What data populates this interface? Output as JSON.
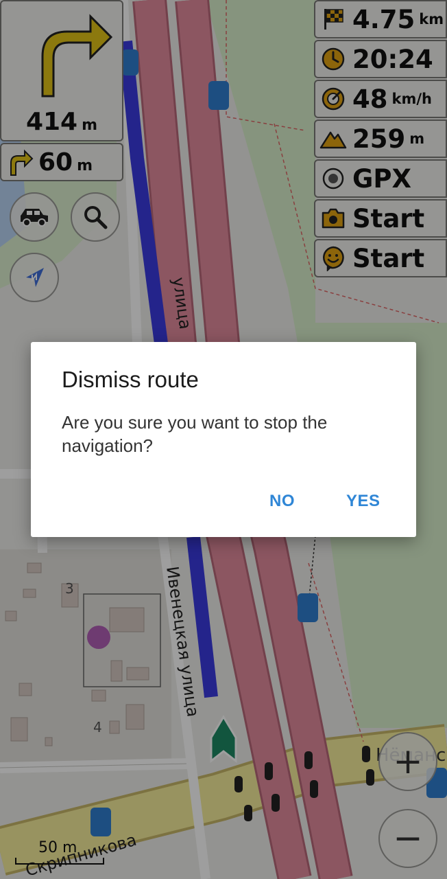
{
  "navigation": {
    "main_turn": {
      "distance": "414",
      "unit": "m",
      "icon": "turn-right-icon"
    },
    "next_turn": {
      "distance": "60",
      "unit": "m",
      "icon": "turn-right-small-icon"
    }
  },
  "widgets": [
    {
      "name": "distance-to-destination",
      "icon": "checkered-flag-icon",
      "value": "4.75",
      "unit": "km"
    },
    {
      "name": "arrival-time",
      "icon": "clock-icon",
      "value": "20:24",
      "unit": ""
    },
    {
      "name": "speed",
      "icon": "speedometer-icon",
      "value": "48",
      "unit": "km/h"
    },
    {
      "name": "altitude",
      "icon": "mountain-icon",
      "value": "259",
      "unit": "m"
    },
    {
      "name": "gpx-recording",
      "icon": "record-target-icon",
      "value": "GPX",
      "unit": ""
    },
    {
      "name": "photo-note",
      "icon": "camera-icon",
      "value": "Start",
      "unit": ""
    },
    {
      "name": "audio-note",
      "icon": "smiley-icon",
      "value": "Start",
      "unit": ""
    }
  ],
  "map": {
    "street_labels": [
      "улица",
      "Ивенецкая улица",
      "Скрипникова",
      "Нёманс"
    ],
    "house_numbers": [
      "3",
      "4"
    ],
    "scale_label": "50 m",
    "zoom_in": "+",
    "zoom_out": "−"
  },
  "dialog": {
    "title": "Dismiss route",
    "message": "Are you sure you want to stop the navigation?",
    "no_label": "NO",
    "yes_label": "YES"
  },
  "colors": {
    "accent": "#2f86d6",
    "route": "#3a3ae0",
    "primary_road": "#e28c9d",
    "secondary_road": "#f6ee9c",
    "widget_icon": "#e3a413",
    "direction_arrow": "#e3c418"
  }
}
